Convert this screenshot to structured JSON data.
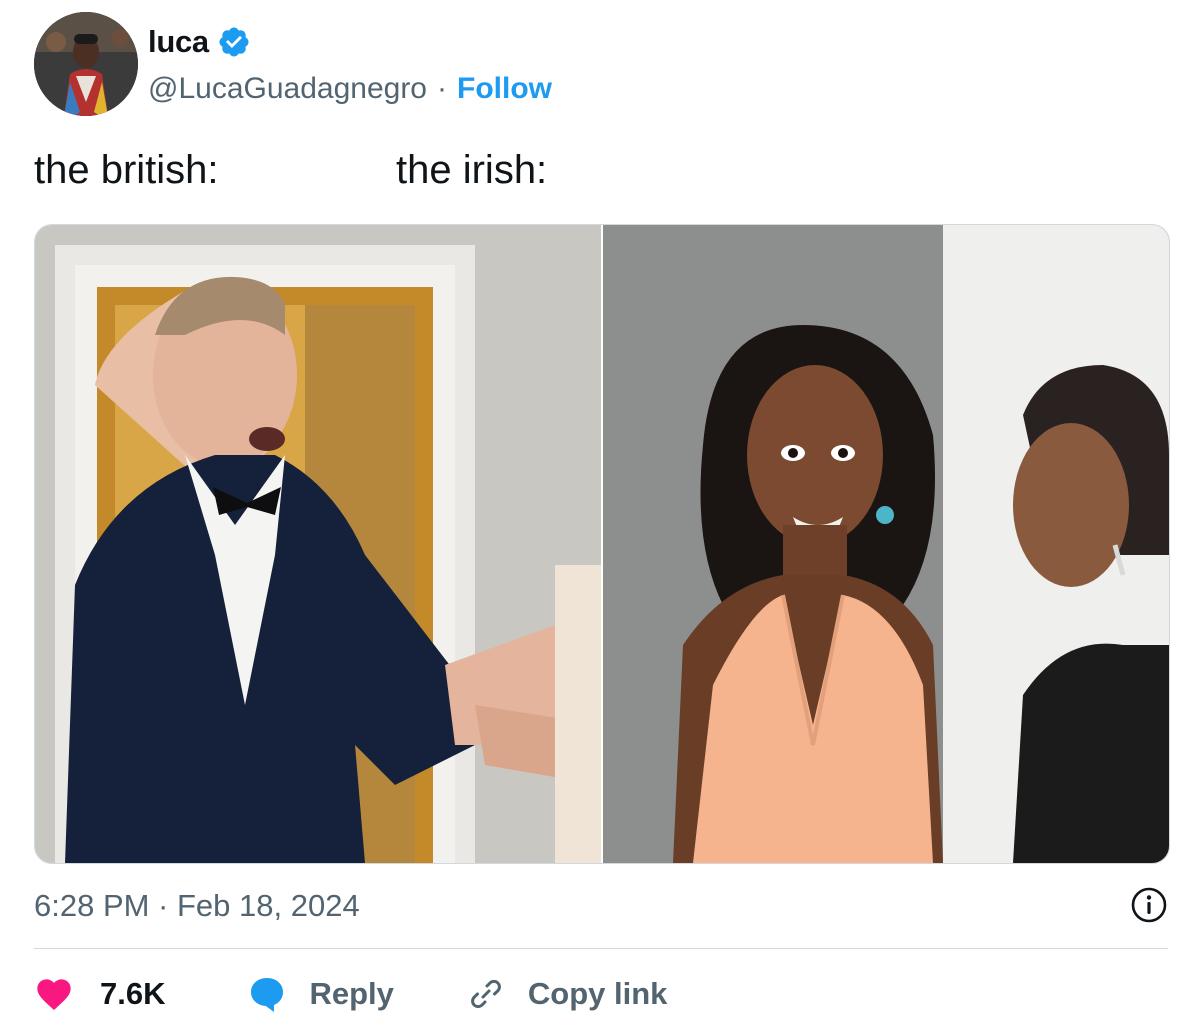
{
  "author": {
    "display_name": "luca",
    "handle": "@LucaGuadagnegro",
    "separator": "·",
    "follow_label": "Follow",
    "verified": true
  },
  "tweet": {
    "caption_left": "the british:",
    "caption_right": "the irish:"
  },
  "media": {
    "count": 2
  },
  "timestamp": "6:28 PM · Feb 18, 2024",
  "actions": {
    "likes": "7.6K",
    "reply_label": "Reply",
    "copy_link_label": "Copy link"
  },
  "colors": {
    "accent": "#1d9bf0",
    "like": "#f91880",
    "muted": "#536471",
    "text": "#0f1419",
    "border": "#cfd9de"
  },
  "icons": [
    "verified-badge-icon",
    "info-icon",
    "heart-icon",
    "reply-bubble-icon",
    "link-icon"
  ]
}
